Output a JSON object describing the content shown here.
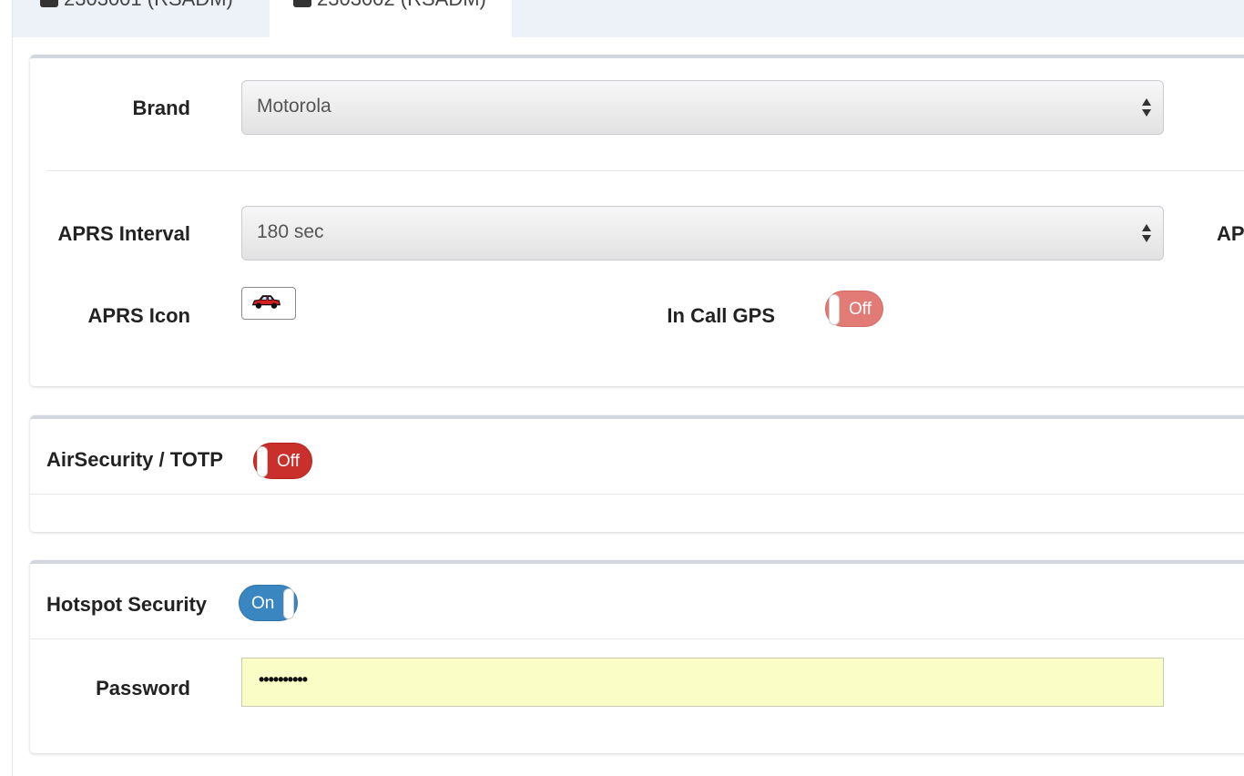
{
  "tabs": [
    {
      "label": "2303001 (RSADM)"
    },
    {
      "label": "2303002 (RSADM)"
    }
  ],
  "radio_settings": {
    "brand": {
      "label": "Brand",
      "value": "Motorola"
    },
    "aprs_interval": {
      "label": "APRS Interval",
      "value": "180 sec"
    },
    "aprs_cut_label": "AP",
    "aprs_icon": {
      "label": "APRS Icon",
      "icon": "car-icon"
    },
    "in_call_gps": {
      "label": "In Call GPS",
      "toggle": "Off"
    }
  },
  "air_security": {
    "label": "AirSecurity / TOTP",
    "toggle": "Off"
  },
  "hotspot_security": {
    "label": "Hotspot Security",
    "toggle": "On",
    "password": {
      "label": "Password",
      "value": "••••••••••"
    }
  },
  "colors": {
    "toggle_off_light": "#e27b76",
    "toggle_off_dark": "#c9302c",
    "toggle_on": "#3a86c0",
    "password_bg": "#fbfdc6",
    "tab_bg": "#edf1f8"
  }
}
